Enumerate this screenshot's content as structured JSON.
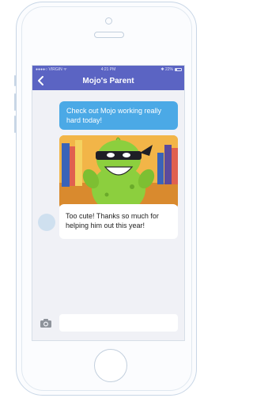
{
  "status_bar": {
    "carrier": "●●●●○ VIRGIN ᯤ",
    "time": "4:21 PM",
    "battery": "✱ 22%"
  },
  "nav": {
    "back_icon": "chevron-left-icon",
    "title": "Mojo's Parent"
  },
  "messages": [
    {
      "direction": "outgoing",
      "text": "Check out Mojo working really hard today!"
    },
    {
      "direction": "outgoing",
      "type": "photo",
      "subject": "green monster with black headband"
    },
    {
      "direction": "incoming",
      "text": "Too cute! Thanks so much for helping him out this year!"
    }
  ],
  "composer": {
    "camera_icon": "camera-icon",
    "placeholder": ""
  },
  "colors": {
    "nav_bar": "#5b64c3",
    "outgoing_bubble": "#4ba9e6",
    "incoming_bubble": "#ffffff",
    "chat_background": "#f0f1f6",
    "phone_outline": "#c8d6e6"
  }
}
